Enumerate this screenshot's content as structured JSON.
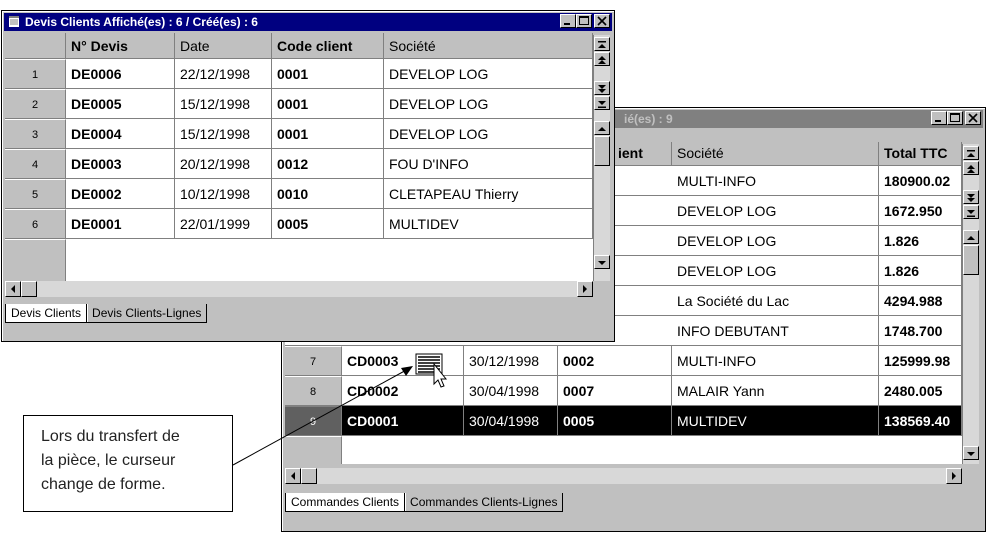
{
  "window_front": {
    "title": "Devis Clients Affiché(es) : 6 / Créé(es) : 6",
    "columns": [
      "N° Devis",
      "Date",
      "Code client",
      "Société"
    ],
    "rows": [
      {
        "num": "1",
        "devis": "DE0006",
        "date": "22/12/1998",
        "code": "0001",
        "societe": "DEVELOP LOG"
      },
      {
        "num": "2",
        "devis": "DE0005",
        "date": "15/12/1998",
        "code": "0001",
        "societe": "DEVELOP LOG"
      },
      {
        "num": "3",
        "devis": "DE0004",
        "date": "15/12/1998",
        "code": "0001",
        "societe": "DEVELOP LOG"
      },
      {
        "num": "4",
        "devis": "DE0003",
        "date": "20/12/1998",
        "code": "0012",
        "societe": "FOU D'INFO"
      },
      {
        "num": "5",
        "devis": "DE0002",
        "date": "10/12/1998",
        "code": "0010",
        "societe": "CLETAPEAU Thierry"
      },
      {
        "num": "6",
        "devis": "DE0001",
        "date": "22/01/1999",
        "code": "0005",
        "societe": "MULTIDEV"
      }
    ],
    "tabs": [
      "Devis Clients",
      "Devis Clients-Lignes"
    ]
  },
  "window_back": {
    "title_partial": "ié(es) : 9",
    "columns": [
      "ient",
      "Société",
      "Total TTC"
    ],
    "rows_partial": [
      {
        "societe": "MULTI-INFO",
        "total": "180900.02"
      },
      {
        "societe": "DEVELOP LOG",
        "total": "1672.950"
      },
      {
        "societe": "DEVELOP LOG",
        "total": "1.826"
      },
      {
        "societe": "DEVELOP LOG",
        "total": "1.826"
      },
      {
        "societe": "La Société du Lac",
        "total": "4294.988"
      },
      {
        "societe": "INFO DEBUTANT",
        "total": "1748.700"
      }
    ],
    "rows_full": [
      {
        "num": "7",
        "cmd": "CD0003",
        "date": "30/12/1998",
        "code": "0002",
        "societe": "MULTI-INFO",
        "total": "125999.98"
      },
      {
        "num": "8",
        "cmd": "CD0002",
        "date": "30/04/1998",
        "code": "0007",
        "societe": "MALAIR Yann",
        "total": "2480.005"
      },
      {
        "num": "9",
        "cmd": "CD0001",
        "date": "30/04/1998",
        "code": "0005",
        "societe": "MULTIDEV",
        "total": "138569.40"
      }
    ],
    "tabs": [
      "Commandes Clients",
      "Commandes Clients-Lignes"
    ]
  },
  "callout": {
    "lines": [
      "Lors du transfert de",
      "la pièce, le curseur",
      "change de forme."
    ]
  },
  "colors": {
    "titlebar_active": "#000080",
    "titlebar_inactive": "#808080",
    "selected_row": "#000000"
  }
}
